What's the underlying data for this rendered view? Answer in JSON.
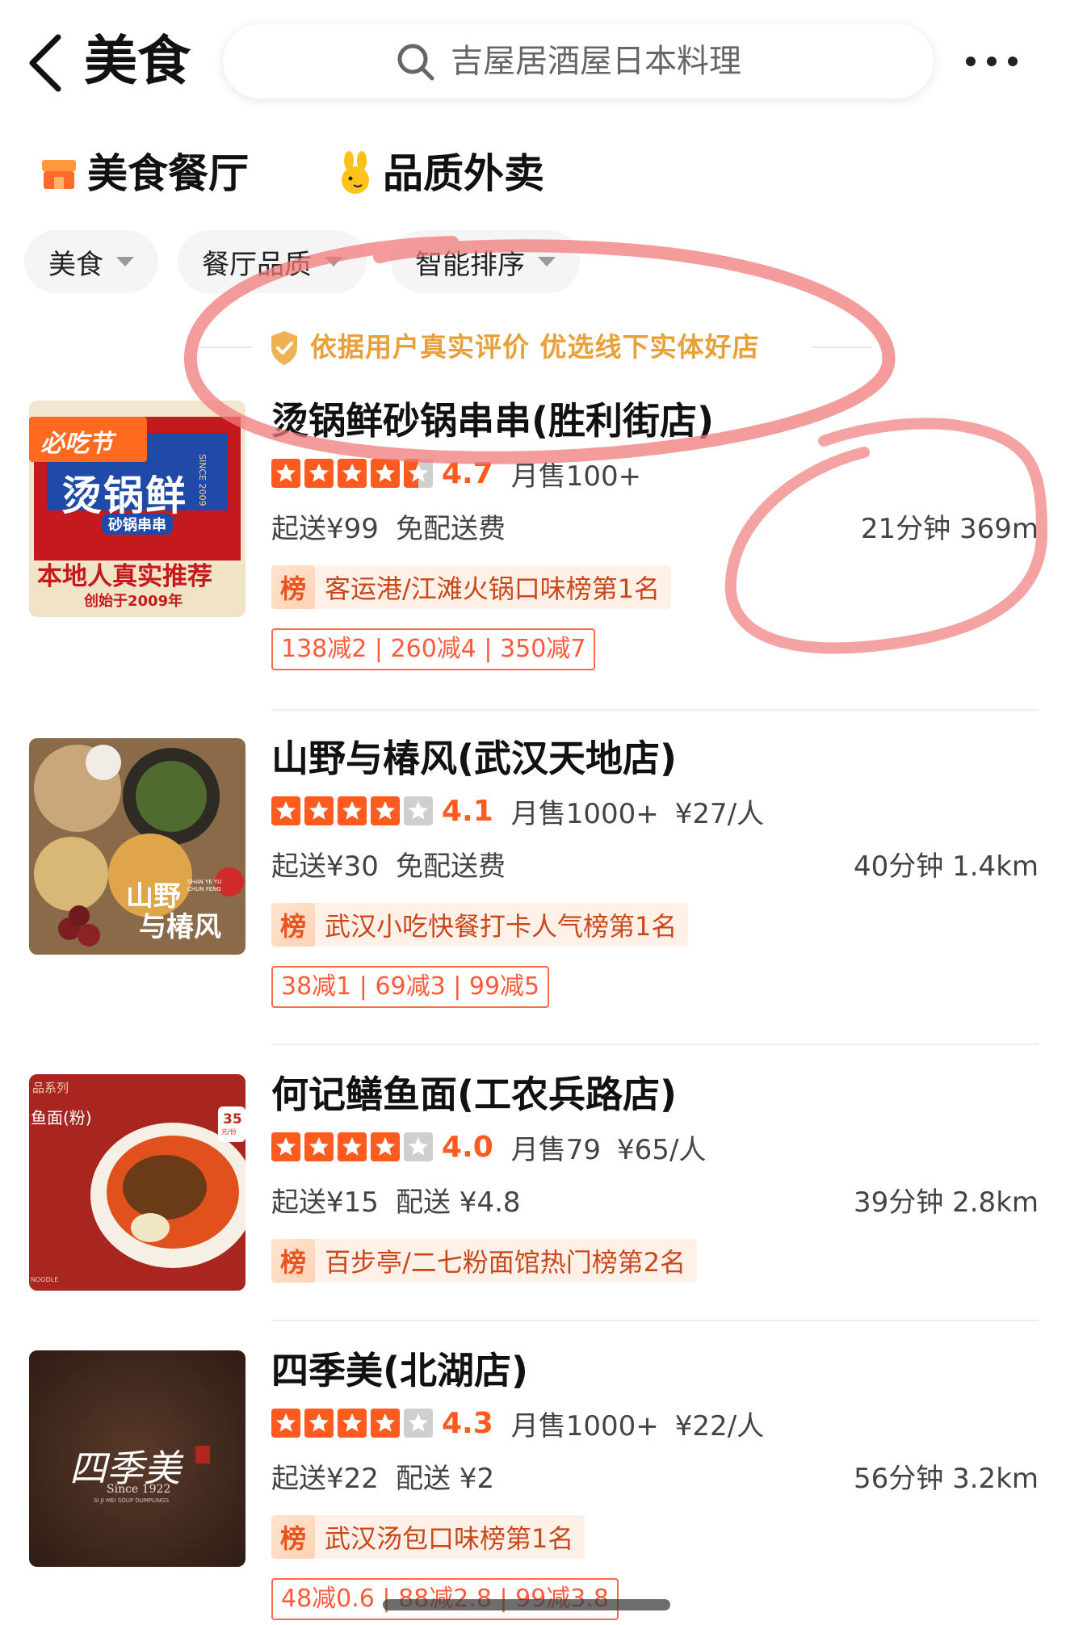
{
  "header": {
    "back_icon": "chevron-left-icon",
    "title": "美食",
    "search_placeholder": "吉屋居酒屋日本料理",
    "search_icon": "search-icon",
    "more_icon": "more-dots-icon"
  },
  "tabs": [
    {
      "label": "美食餐厅",
      "icon": "storefront-icon",
      "active": false
    },
    {
      "label": "品质外卖",
      "icon": "kangaroo-mascot-icon",
      "active": true
    }
  ],
  "filters": [
    {
      "label": "美食"
    },
    {
      "label": "餐厅品质"
    },
    {
      "label": "智能排序"
    }
  ],
  "notice": {
    "icon": "shield-check-icon",
    "text": "依据用户真实评价  优选线下实体好店"
  },
  "colors": {
    "accent": "#ff5a1f",
    "notice": "#e8a03a",
    "rank_bg": "#fff1e8",
    "promo_border": "#ff6a4a",
    "annotation": "#f07a7a"
  },
  "restaurants": [
    {
      "name": "烫锅鲜砂锅串串(胜利街店)",
      "stars": 4.5,
      "score": "4.7",
      "sales": "月售100+",
      "price": "",
      "min_order": "起送¥99",
      "fee": "免配送费",
      "eta": "21分钟  369m",
      "rank_badge": "榜",
      "rank": "客运港/江滩火锅口味榜第1名",
      "promo": "138减2 | 260减4 | 350减7",
      "thumb": {
        "tag": "必吃节",
        "brand": "烫锅鲜",
        "sub": "砂锅串串",
        "slogan": "本地人真实推荐",
        "since": "创始于2009年",
        "side": "SINCE 2009"
      }
    },
    {
      "name": "山野与椿风(武汉天地店)",
      "stars": 4,
      "score": "4.1",
      "sales": "月售1000+",
      "price": "¥27/人",
      "min_order": "起送¥30",
      "fee": "免配送费",
      "eta": "40分钟  1.4km",
      "rank_badge": "榜",
      "rank": "武汉小吃快餐打卡人气榜第1名",
      "promo": "38减1 | 69减3 | 99减5",
      "thumb": {
        "brand_line1": "山野",
        "brand_line2": "与椿风",
        "en": "SHAN YE YU CHUN FENG"
      }
    },
    {
      "name": "何记鳝鱼面(工农兵路店)",
      "stars": 4,
      "score": "4.0",
      "sales": "月售79",
      "price": "¥65/人",
      "min_order": "起送¥15",
      "fee": "配送 ¥4.8",
      "eta": "39分钟  2.8km",
      "rank_badge": "榜",
      "rank": "百步亭/二七粉面馆热门榜第2名",
      "promo": "",
      "thumb": {
        "series": "品系列",
        "dish": "鱼面(粉)",
        "price_tag": "35",
        "unit": "元/份",
        "en": "NOODLE"
      }
    },
    {
      "name": "四季美(北湖店)",
      "stars": 4,
      "score": "4.3",
      "sales": "月售1000+",
      "price": "¥22/人",
      "min_order": "起送¥22",
      "fee": "配送 ¥2",
      "eta": "56分钟  3.2km",
      "rank_badge": "榜",
      "rank": "武汉汤包口味榜第1名",
      "promo": "48减0.6 | 88减2.8 | 99减3.8",
      "thumb": {
        "brand": "四季美",
        "since": "Since 1922",
        "en": "SI JI MEI SOUP DUMPLINGS"
      }
    }
  ]
}
